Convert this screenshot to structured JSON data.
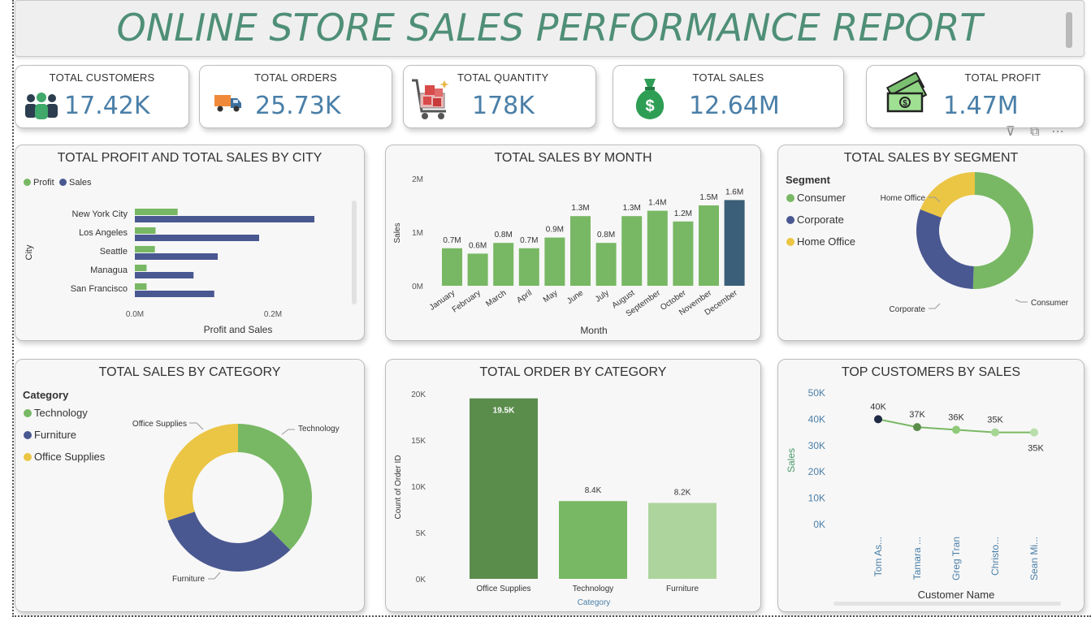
{
  "report": {
    "title": "ONLINE STORE SALES PERFORMANCE REPORT"
  },
  "kpis": [
    {
      "label": "TOTAL CUSTOMERS",
      "value": "17.42K",
      "icon": "customers-icon"
    },
    {
      "label": "TOTAL ORDERS",
      "value": "25.73K",
      "icon": "delivery-truck-icon"
    },
    {
      "label": "TOTAL QUANTITY",
      "value": "178K",
      "icon": "shopping-cart-icon"
    },
    {
      "label": "TOTAL SALES",
      "value": "12.64M",
      "icon": "money-bag-icon"
    },
    {
      "label": "TOTAL PROFIT",
      "value": "1.47M",
      "icon": "cash-stack-icon"
    }
  ],
  "colors": {
    "green": "#78b864",
    "navy": "#4a5891",
    "yellow": "#ebc544",
    "darkgreen": "#5a8d4c",
    "lightgreen": "#add49c",
    "december": "#3b5f78",
    "title": "#4f8f77",
    "kpi": "#4a7fa8"
  },
  "chart_data": [
    {
      "id": "profit-sales-by-city",
      "type": "bar",
      "orientation": "horizontal",
      "title": "TOTAL PROFIT AND TOTAL SALES BY CITY",
      "xlabel": "Profit and Sales",
      "ylabel": "City",
      "categories": [
        "New York City",
        "Los Angeles",
        "Seattle",
        "Managua",
        "San Francisco"
      ],
      "series": [
        {
          "name": "Profit",
          "values": [
            0.062,
            0.03,
            0.029,
            0.017,
            0.017
          ]
        },
        {
          "name": "Sales",
          "values": [
            0.26,
            0.18,
            0.12,
            0.085,
            0.115
          ]
        }
      ],
      "x_ticks": [
        "0.0M",
        "0.2M"
      ],
      "xlim": [
        0,
        0.33
      ],
      "legend": "top-left"
    },
    {
      "id": "sales-by-month",
      "type": "bar",
      "title": "TOTAL SALES BY MONTH",
      "xlabel": "Month",
      "ylabel": "Sales",
      "categories": [
        "January",
        "February",
        "March",
        "April",
        "May",
        "June",
        "July",
        "August",
        "September",
        "October",
        "November",
        "December"
      ],
      "values": [
        0.7,
        0.6,
        0.8,
        0.7,
        0.9,
        1.3,
        0.8,
        1.3,
        1.4,
        1.2,
        1.5,
        1.6
      ],
      "data_labels": [
        "0.7M",
        "0.6M",
        "0.8M",
        "0.7M",
        "0.9M",
        "1.3M",
        "0.8M",
        "1.3M",
        "1.4M",
        "1.2M",
        "1.5M",
        "1.6M"
      ],
      "y_ticks": [
        "0M",
        "1M",
        "2M"
      ],
      "ylim": [
        0,
        2
      ]
    },
    {
      "id": "sales-by-segment",
      "type": "pie",
      "donut": true,
      "title": "TOTAL SALES BY SEGMENT",
      "legend_title": "Segment",
      "categories": [
        "Consumer",
        "Corporate",
        "Home Office"
      ],
      "values": [
        50.5,
        30.4,
        19.1
      ],
      "legend": "top-left"
    },
    {
      "id": "sales-by-category",
      "type": "pie",
      "donut": true,
      "title": "TOTAL SALES BY CATEGORY",
      "legend_title": "Category",
      "categories": [
        "Technology",
        "Furniture",
        "Office Supplies"
      ],
      "values": [
        37.5,
        32.5,
        30.0
      ],
      "legend": "top-left"
    },
    {
      "id": "order-by-category",
      "type": "bar",
      "title": "TOTAL ORDER BY CATEGORY",
      "xlabel": "Category",
      "ylabel": "Count of Order ID",
      "categories": [
        "Office Supplies",
        "Technology",
        "Furniture"
      ],
      "values": [
        19.5,
        8.4,
        8.2
      ],
      "data_labels": [
        "19.5K",
        "8.4K",
        "8.2K"
      ],
      "y_ticks": [
        "0K",
        "5K",
        "10K",
        "15K",
        "20K"
      ],
      "ylim": [
        0,
        20
      ]
    },
    {
      "id": "top-customers",
      "type": "line",
      "title": "TOP CUSTOMERS BY SALES",
      "xlabel": "Customer Name",
      "ylabel": "Sales",
      "categories": [
        "Tom As...",
        "Tamara ...",
        "Greg Tran",
        "Christo...",
        "Sean Mi..."
      ],
      "values": [
        40,
        37,
        36,
        35,
        35
      ],
      "data_labels": [
        "40K",
        "37K",
        "36K",
        "35K",
        "35K"
      ],
      "y_ticks": [
        "0K",
        "10K",
        "20K",
        "30K",
        "40K",
        "50K"
      ],
      "ylim": [
        0,
        50
      ]
    }
  ]
}
